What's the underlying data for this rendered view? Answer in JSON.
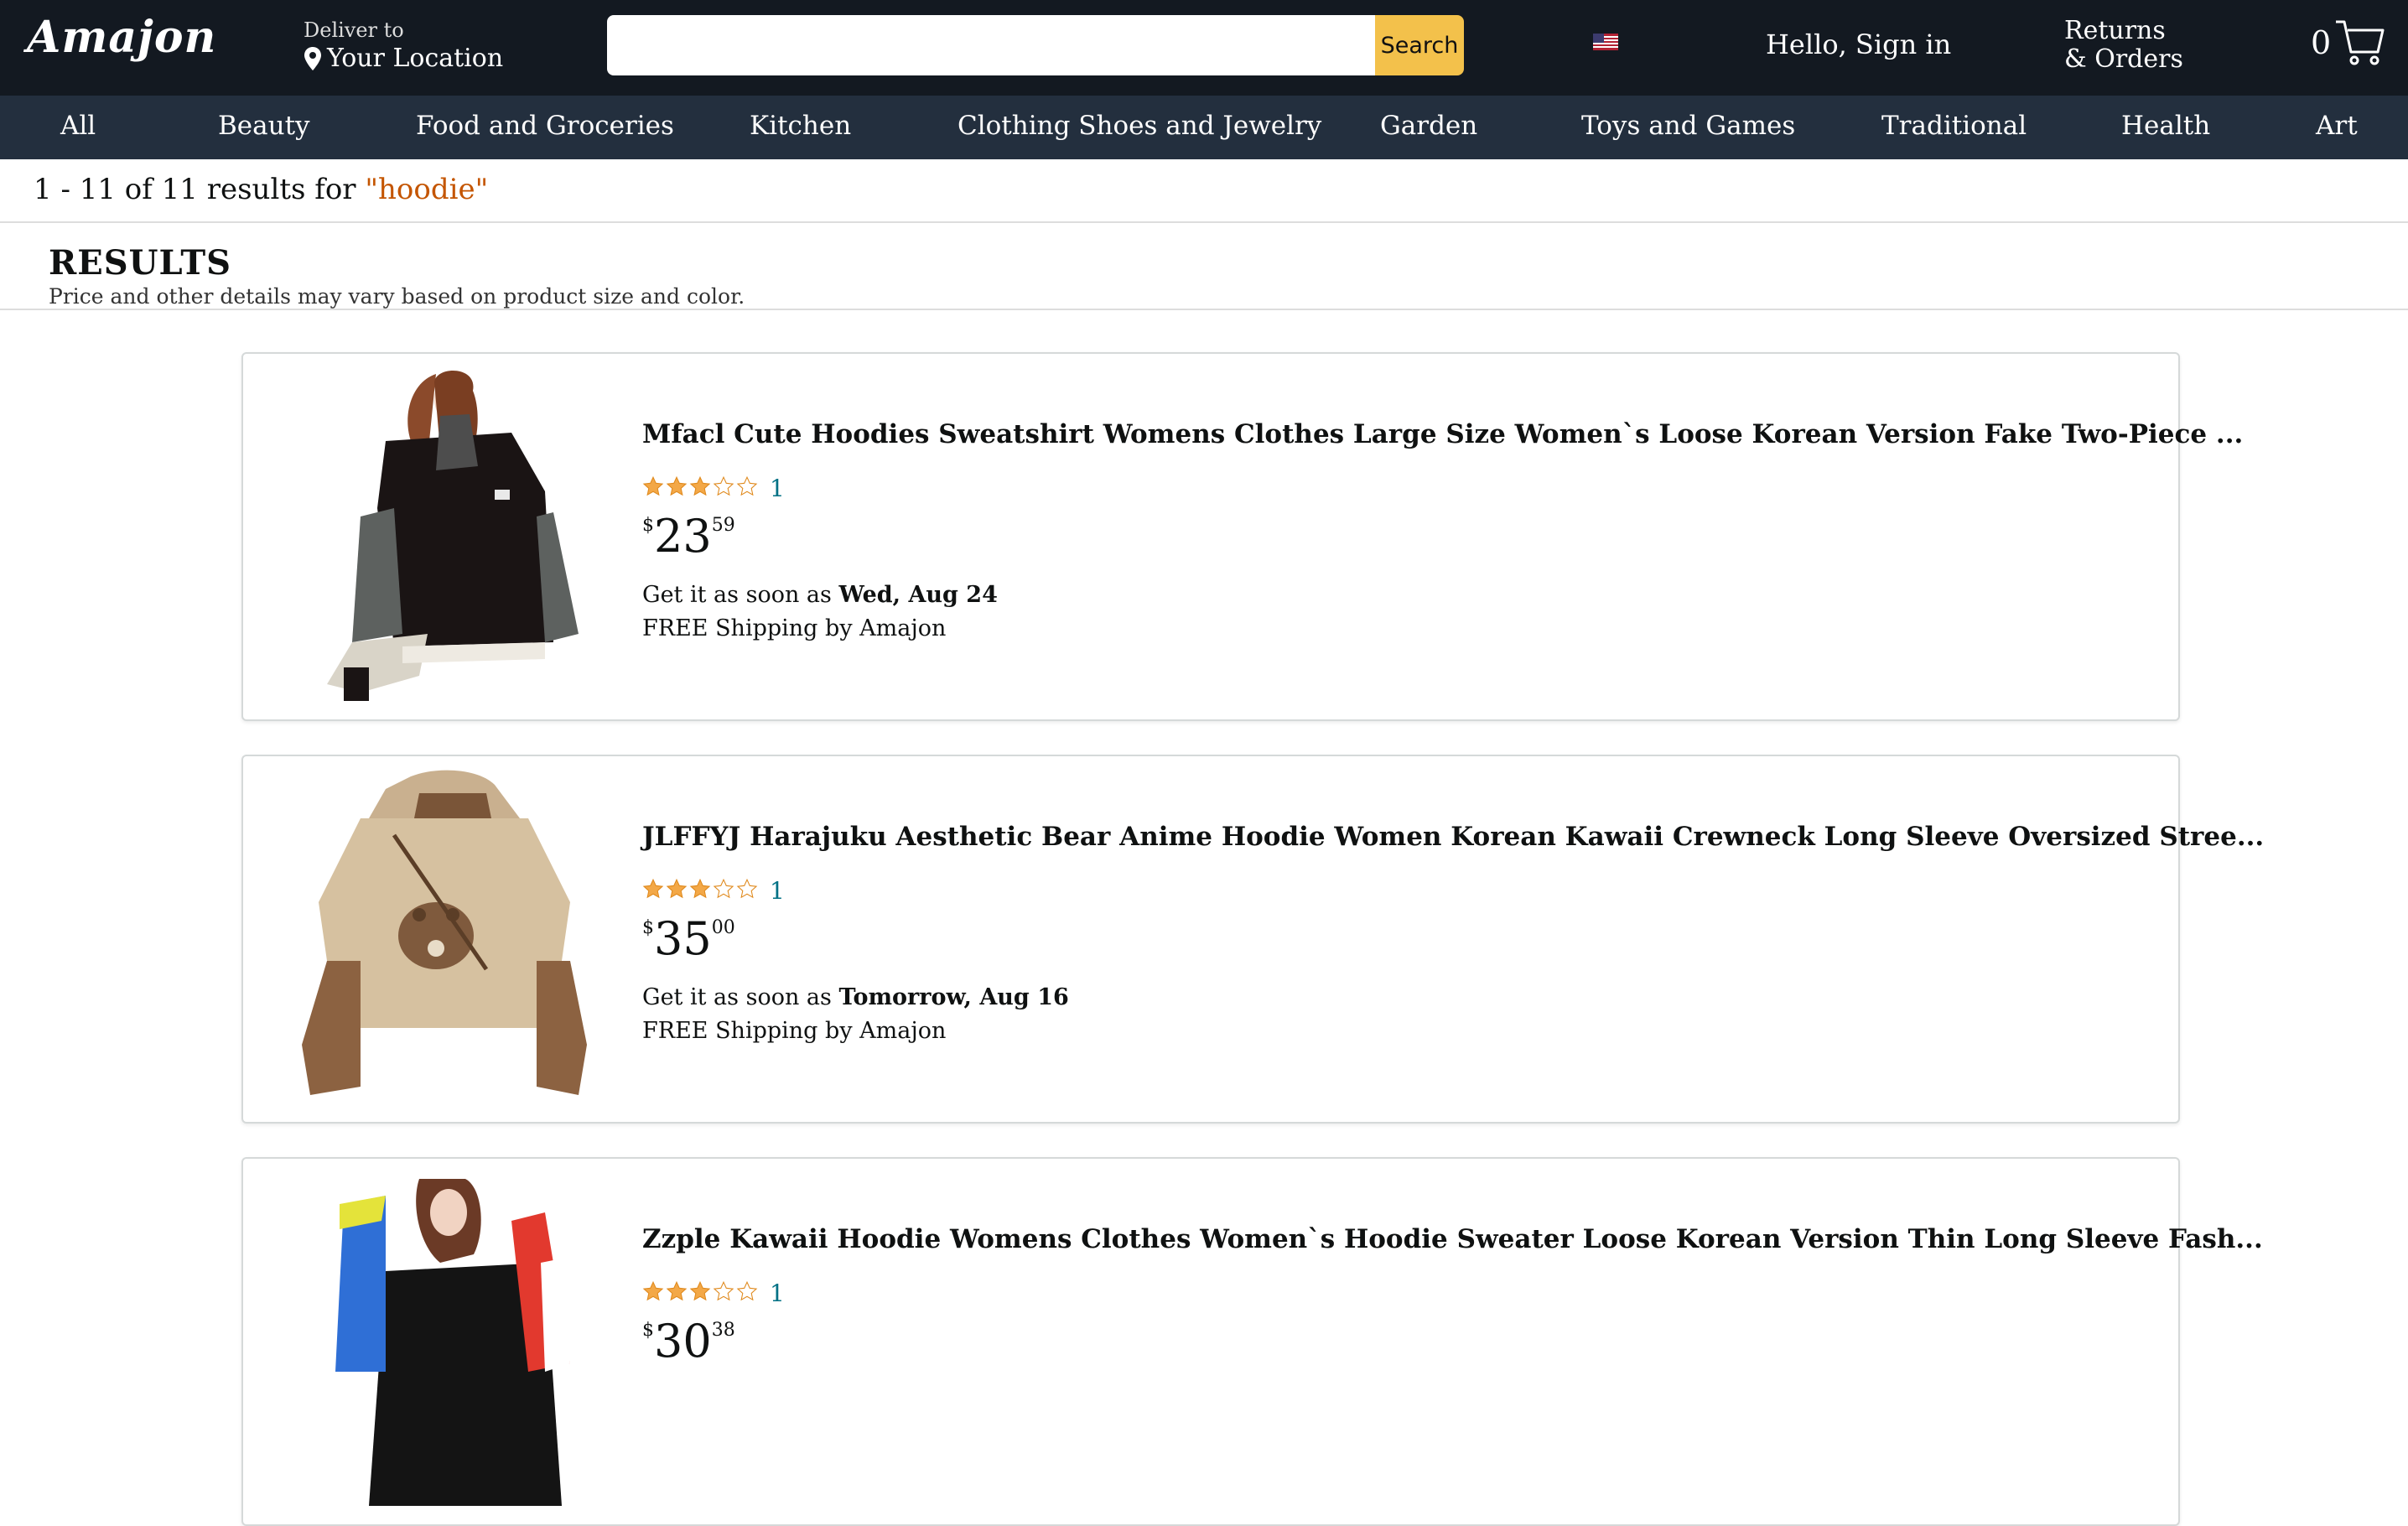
{
  "header": {
    "logo": "Amajon",
    "deliver_small": "Deliver to",
    "deliver_big": "Your Location",
    "search_value": "",
    "search_placeholder": "",
    "search_button": "Search",
    "signin": "Hello, Sign in",
    "returns_line1": "Returns",
    "returns_line2": "& Orders",
    "cart_count": "0"
  },
  "categories": [
    "All",
    "Beauty",
    "Food and Groceries",
    "Kitchen",
    "Clothing Shoes and Jewelry",
    "Garden",
    "Toys and Games",
    "Traditional",
    "Health",
    "Art"
  ],
  "results": {
    "count_text": "1 - 11 of 11 results for ",
    "query": "\"hoodie\"",
    "heading": "RESULTS",
    "subheading": "Price and other details may vary based on product size and color."
  },
  "products": [
    {
      "title": "Mfacl Cute Hoodies Sweatshirt Womens Clothes Large Size Women`s Loose Korean Version Fake Two-Piece ...",
      "rating_stars": 3,
      "rating_count": "1",
      "price_symbol": "$",
      "price_whole": "23",
      "price_fraction": "59",
      "delivery_prefix": "Get it as soon as ",
      "delivery_date": "Wed, Aug 24",
      "shipping": "FREE Shipping by Amajon"
    },
    {
      "title": "JLFFYJ Harajuku Aesthetic Bear Anime Hoodie Women Korean Kawaii Crewneck Long Sleeve Oversized Stree...",
      "rating_stars": 3,
      "rating_count": "1",
      "price_symbol": "$",
      "price_whole": "35",
      "price_fraction": "00",
      "delivery_prefix": "Get it as soon as ",
      "delivery_date": "Tomorrow, Aug 16",
      "shipping": "FREE Shipping by Amajon"
    },
    {
      "title": "Zzple Kawaii Hoodie Womens Clothes Women`s Hoodie Sweater Loose Korean Version Thin Long Sleeve Fash...",
      "rating_stars": 3,
      "rating_count": "1",
      "price_symbol": "$",
      "price_whole": "30",
      "price_fraction": "38"
    }
  ],
  "colors": {
    "header_bg": "#131921",
    "nav_bg": "#232f3e",
    "search_button": "#f3c14b",
    "star": "#f3a847",
    "link": "#007185",
    "query": "#c45500"
  },
  "icons": [
    "pin-icon",
    "flag-icon",
    "cart-icon",
    "star-icon"
  ]
}
